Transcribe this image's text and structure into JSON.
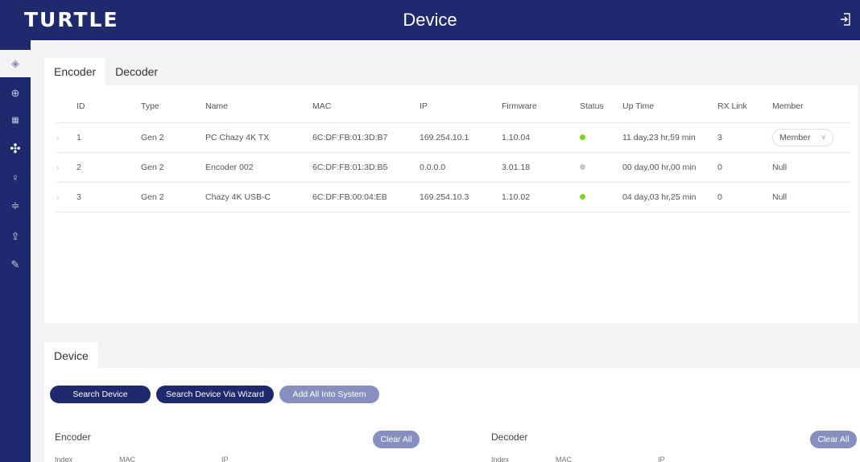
{
  "header": {
    "logo": "TURTLE",
    "title": "Device"
  },
  "sidebar": {
    "items": [
      {
        "icon": "layers-icon",
        "glyph": "◈"
      },
      {
        "icon": "plus-circle-icon",
        "glyph": "⊕"
      },
      {
        "icon": "grid-icon",
        "glyph": "▦"
      },
      {
        "icon": "network-icon",
        "glyph": "✣"
      },
      {
        "icon": "user-icon",
        "glyph": "♀"
      },
      {
        "icon": "sliders-icon",
        "glyph": "≑"
      },
      {
        "icon": "upload-icon",
        "glyph": "⇪"
      },
      {
        "icon": "wrench-icon",
        "glyph": "✎"
      }
    ]
  },
  "tabs": {
    "encoder": "Encoder",
    "decoder": "Decoder"
  },
  "table": {
    "headers": {
      "id": "ID",
      "type": "Type",
      "name": "Name",
      "mac": "MAC",
      "ip": "IP",
      "firmware": "Firmware",
      "status": "Status",
      "uptime": "Up Time",
      "rxlink": "RX Link",
      "member": "Member"
    },
    "rows": [
      {
        "id": "1",
        "type": "Gen 2",
        "name": "PC Chazy 4K TX",
        "mac": "6C:DF:FB:01:3D:B7",
        "ip": "169.254.10.1",
        "firmware": "1.10.04",
        "status_color": "#7ed321",
        "uptime": "11 day,23 hr,59 min",
        "rxlink": "3",
        "member": "Member"
      },
      {
        "id": "2",
        "type": "Gen 2",
        "name": "Encoder 002",
        "mac": "6C:DF:FB:01:3D:B5",
        "ip": "0.0.0.0",
        "firmware": "3.01.18",
        "status_color": "#c8c8c8",
        "uptime": "00 day,00 hr,00 min",
        "rxlink": "0",
        "member": "Null"
      },
      {
        "id": "3",
        "type": "Gen 2",
        "name": "Chazy 4K USB-C",
        "mac": "6C:DF:FB:00:04:EB",
        "ip": "169.254.10.3",
        "firmware": "1.10.02",
        "status_color": "#7ed321",
        "uptime": "04 day,03 hr,25 min",
        "rxlink": "0",
        "member": "Null"
      }
    ]
  },
  "bottom": {
    "tab": "Device",
    "search_btn": "Search Device",
    "wizard_btn": "Search Device Via Wizard",
    "add_all_btn": "Add All Into System",
    "encoder_label": "Encoder",
    "decoder_label": "Decoder",
    "clear_all": "Clear All",
    "col_index": "Index",
    "col_mac": "MAC",
    "col_ip": "IP"
  },
  "colors": {
    "navy": "#1f2a6e",
    "light_btn": "#8590c0",
    "online": "#7ed321",
    "offline": "#c8c8c8"
  }
}
